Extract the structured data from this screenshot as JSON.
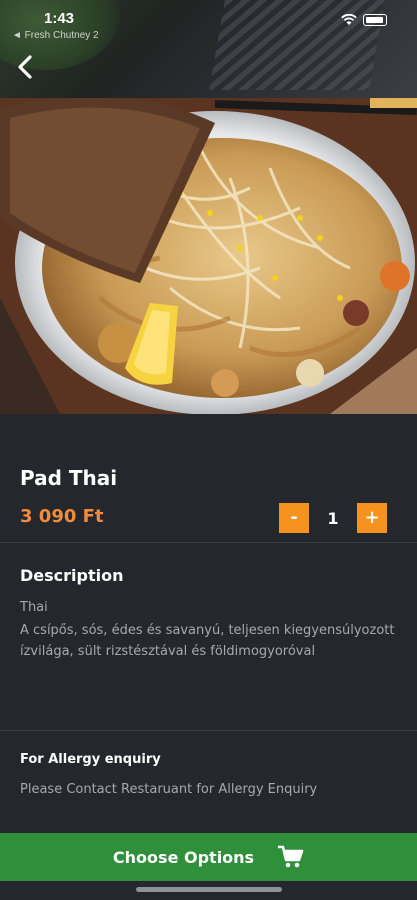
{
  "status_bar": {
    "time": "1:43",
    "back_to_app": "◄ Fresh Chutney 2"
  },
  "navigation": {
    "back_icon": "chevron-left-icon"
  },
  "dish": {
    "name": "Pad Thai",
    "price": "3 090 Ft",
    "quantity": "1",
    "decrement_label": "-",
    "increment_label": "+"
  },
  "description": {
    "title": "Description",
    "category": "Thai",
    "text": "A csípős, sós, édes és savanyú, teljesen kiegyensúlyozott ízvilága, sült rizstésztával és földimogyoróval"
  },
  "allergy": {
    "title": "For Allergy enquiry",
    "text": "Please Contact Restaruant for Allergy Enquiry"
  },
  "cta": {
    "label": "Choose Options",
    "icon": "cart-icon"
  },
  "colors": {
    "background": "#24272c",
    "price": "#f28c3a",
    "quantity_buttons": "#f5931e",
    "cta": "#2f8f3b"
  }
}
